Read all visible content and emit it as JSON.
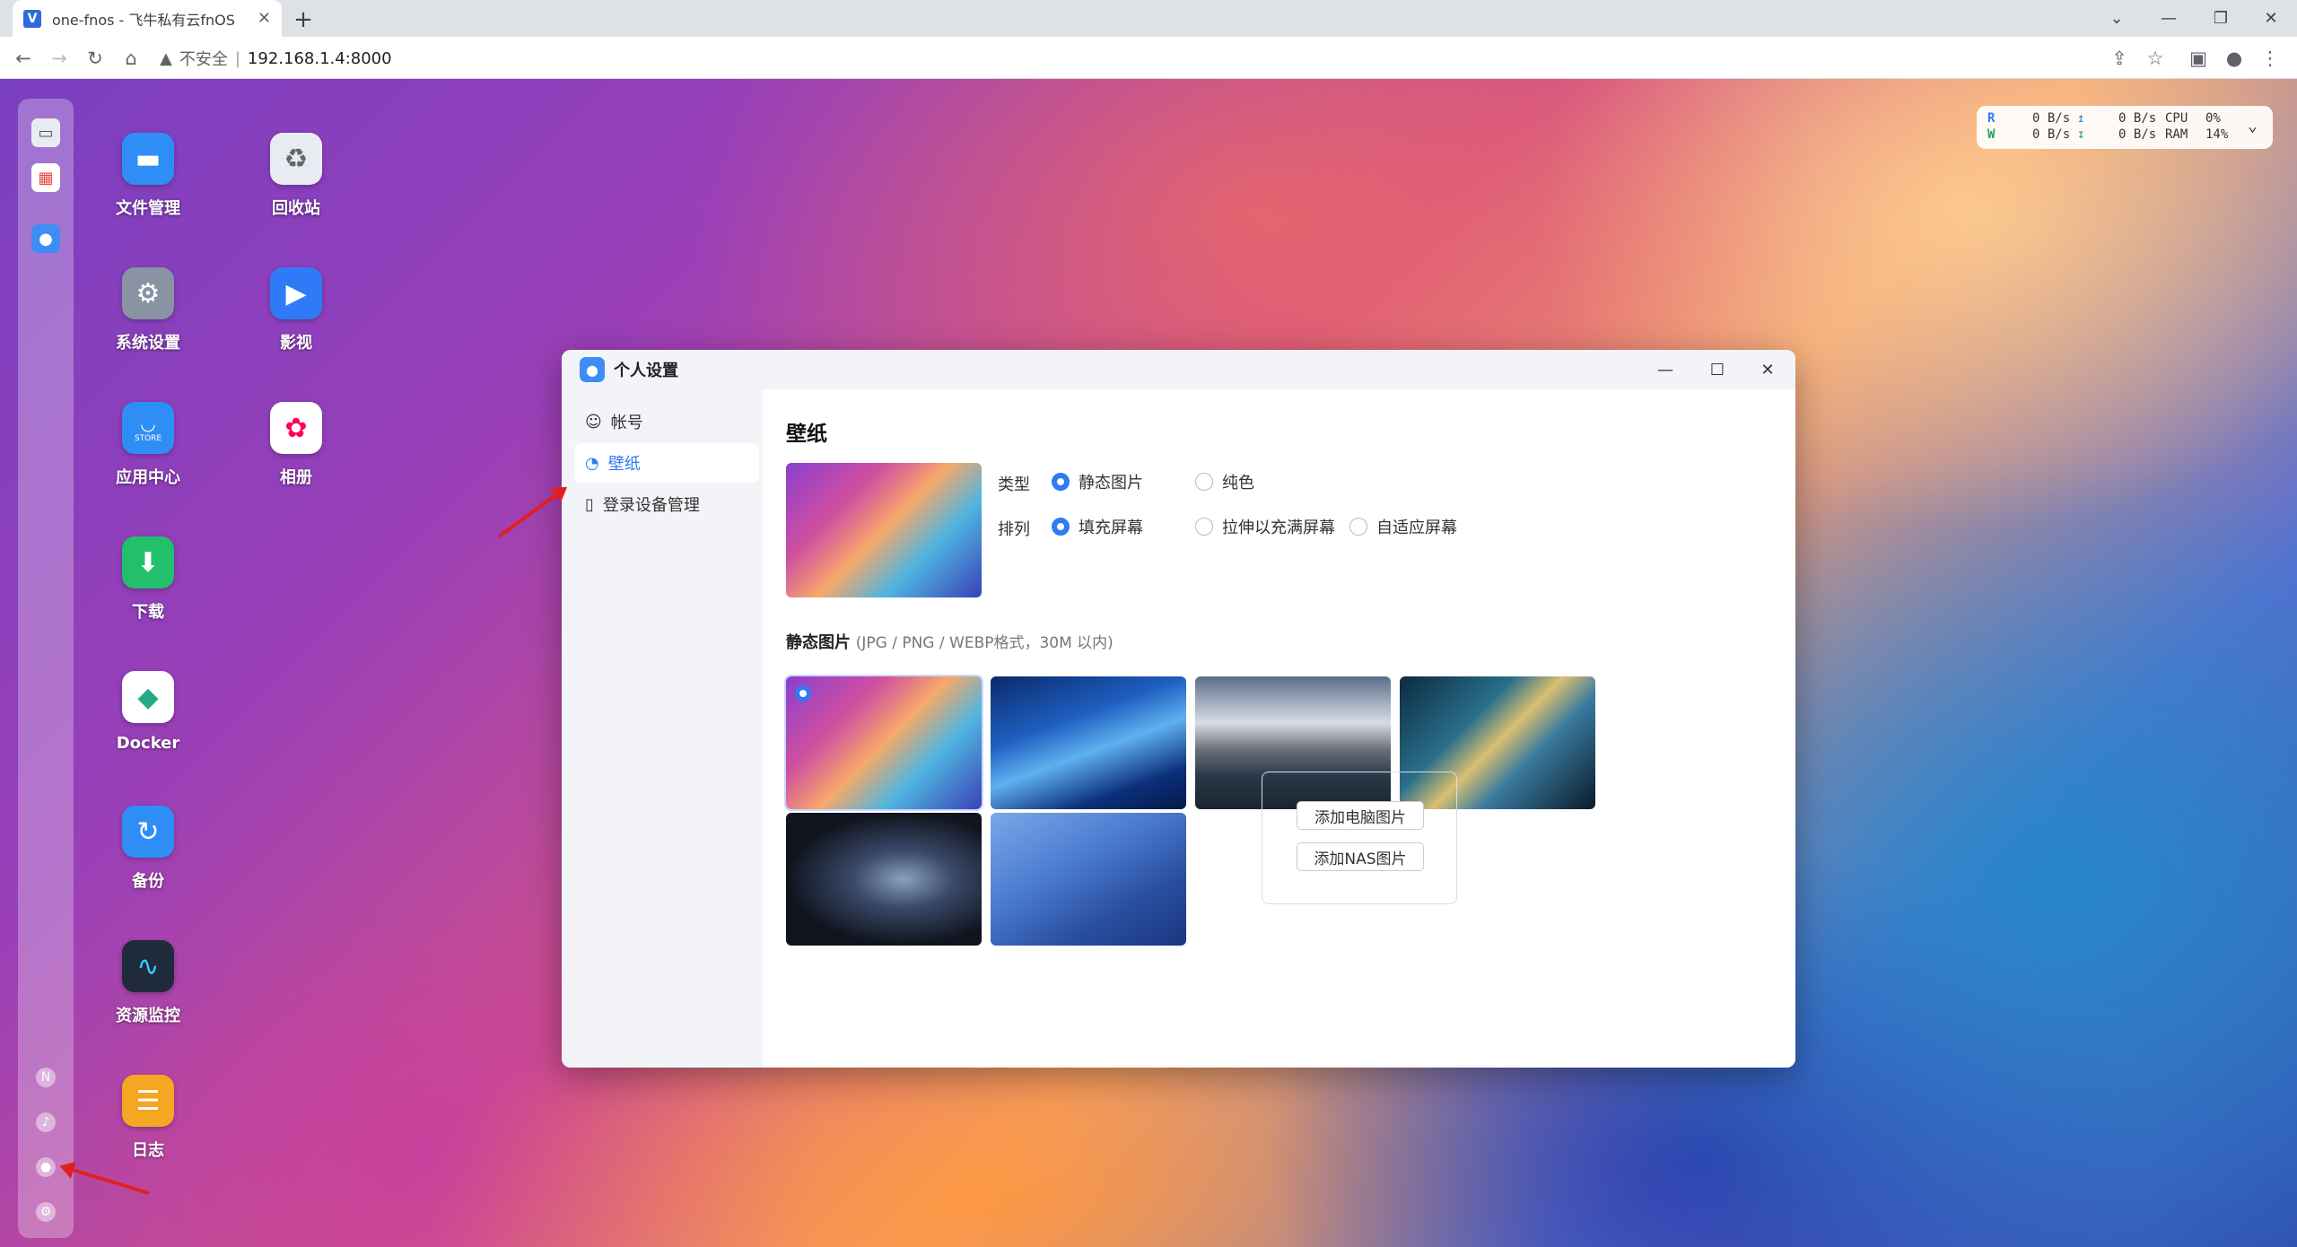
{
  "browser": {
    "tab_title": "one-fnos - 飞牛私有云fnOS",
    "favicon": "fnos-logo",
    "security_label": "不安全",
    "url": "192.168.1.4:8000"
  },
  "desktop": {
    "apps": [
      {
        "label": "文件管理",
        "icon": "folder-icon",
        "color": "#2f8ef5"
      },
      {
        "label": "回收站",
        "icon": "recycle-icon",
        "color": "#e8ecf2"
      },
      {
        "label": "系统设置",
        "icon": "gear-icon",
        "color": "#8a93a3"
      },
      {
        "label": "影视",
        "icon": "video-icon",
        "color": "#2f7af6"
      },
      {
        "label": "应用中心",
        "icon": "store-icon",
        "color": "#2f8ef5"
      },
      {
        "label": "相册",
        "icon": "photos-icon",
        "color": "#ffffff"
      },
      {
        "label": "下载",
        "icon": "download-icon",
        "color": "#22c06a"
      },
      {
        "label": "Docker",
        "icon": "docker-icon",
        "color": "#ffffff"
      },
      {
        "label": "备份",
        "icon": "backup-icon",
        "color": "#2f8ef5"
      },
      {
        "label": "资源监控",
        "icon": "monitor-icon",
        "color": "#1f2a3a"
      },
      {
        "label": "日志",
        "icon": "log-icon",
        "color": "#f5a623"
      }
    ],
    "store_caption": "STORE"
  },
  "monitor": {
    "r_label": "R",
    "w_label": "W",
    "r_rate1": "0 B/s",
    "w_rate1": "0 B/s",
    "r_rate2": "0 B/s",
    "w_rate2": "0 B/s",
    "cpu_label": "CPU",
    "ram_label": "RAM",
    "cpu_value": "0%",
    "ram_value": "14%"
  },
  "window": {
    "title": "个人设置",
    "nav": [
      {
        "label": "帐号",
        "icon": "user-icon"
      },
      {
        "label": "壁纸",
        "icon": "palette-icon",
        "active": true
      },
      {
        "label": "登录设备管理",
        "icon": "device-icon"
      }
    ],
    "pane_title": "壁纸",
    "type_label": "类型",
    "type_options": [
      "静态图片",
      "纯色"
    ],
    "type_selected": "静态图片",
    "arrange_label": "排列",
    "arrange_options": [
      "填充屏幕",
      "拉伸以充满屏幕",
      "自适应屏幕"
    ],
    "arrange_selected": "填充屏幕",
    "section_title": "静态图片",
    "section_hint": "(JPG / PNG / WEBP格式，30M 以内)",
    "add_pc_button": "添加电脑图片",
    "add_nas_button": "添加NAS图片"
  },
  "colors": {
    "accent": "#2f7af6",
    "annotation_arrow": "#e02020"
  }
}
